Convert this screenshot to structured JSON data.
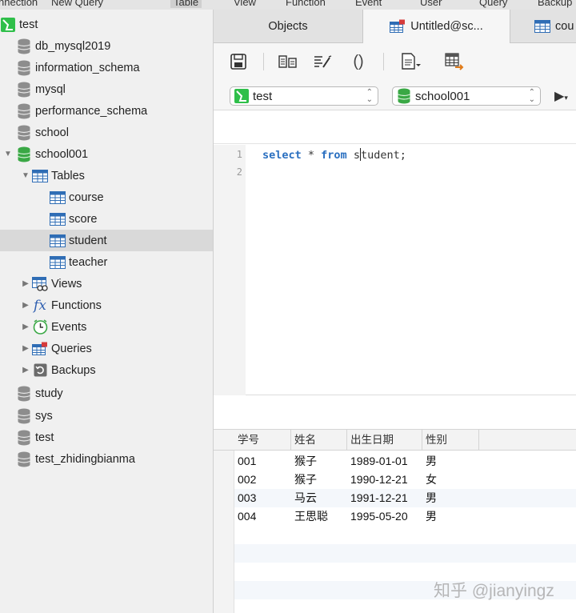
{
  "menu": {
    "items": [
      "nnection",
      "New Query",
      "Table",
      "View",
      "Function",
      "Event",
      "User",
      "Query",
      "Backup"
    ],
    "active_index": 2
  },
  "sidebar": {
    "connection": {
      "label": "test",
      "icon": "connection-icon",
      "expanded": true
    },
    "databases": [
      {
        "label": "db_mysql2019",
        "icon": "database-icon"
      },
      {
        "label": "information_schema",
        "icon": "database-icon"
      },
      {
        "label": "mysql",
        "icon": "database-icon"
      },
      {
        "label": "performance_schema",
        "icon": "database-icon"
      },
      {
        "label": "school",
        "icon": "database-icon"
      },
      {
        "label": "school001",
        "icon": "database-active-icon",
        "expanded": true
      },
      {
        "label": "study",
        "icon": "database-icon"
      },
      {
        "label": "sys",
        "icon": "database-icon"
      },
      {
        "label": "test",
        "icon": "database-icon"
      },
      {
        "label": "test_zhidingbianma",
        "icon": "database-icon"
      }
    ],
    "school001_children": {
      "tables_label": "Tables",
      "tables": [
        "course",
        "score",
        "student",
        "teacher"
      ],
      "selected_table": "student",
      "groups": [
        {
          "label": "Views",
          "icon": "views-icon"
        },
        {
          "label": "Functions",
          "icon": "function-icon"
        },
        {
          "label": "Events",
          "icon": "clock-icon"
        },
        {
          "label": "Queries",
          "icon": "query-icon"
        },
        {
          "label": "Backups",
          "icon": "backup-icon"
        }
      ]
    }
  },
  "tabs": [
    {
      "label": "Objects",
      "active": false
    },
    {
      "label": "Untitled@sc...",
      "active": true,
      "icon": "query-icon"
    },
    {
      "label": "cou",
      "active": false,
      "icon": "table-icon"
    }
  ],
  "toolbar": {
    "icons": [
      "save-icon",
      "explain-icon",
      "beautify-icon",
      "parentheses-icon",
      "snippet-icon",
      "table-export-icon"
    ]
  },
  "selectors": {
    "connection": {
      "label": "test",
      "icon": "connection-icon"
    },
    "database": {
      "label": "school001",
      "icon": "database-active-icon"
    }
  },
  "editor": {
    "line_numbers": [
      "1",
      "2"
    ],
    "kw1": "select",
    "sym": " * ",
    "kw2": "from",
    "text_before_caret": " s",
    "text_after_caret": "tudent;"
  },
  "grid": {
    "columns": [
      "学号",
      "姓名",
      "出生日期",
      "性别"
    ],
    "rows": [
      [
        "001",
        "猴子",
        "1989-01-01",
        "男"
      ],
      [
        "002",
        "猴子",
        "1990-12-21",
        "女"
      ],
      [
        "003",
        "马云",
        "1991-12-21",
        "男"
      ],
      [
        "004",
        "王思聪",
        "1995-05-20",
        "男"
      ]
    ]
  },
  "watermark": "知乎 @jianyingz",
  "colors": {
    "keyword": "#2a6fc0",
    "database_active": "#3aa845",
    "connection": "#2fbf4a",
    "selection": "#d9d9d9",
    "table_icon": "#2f6db5"
  }
}
